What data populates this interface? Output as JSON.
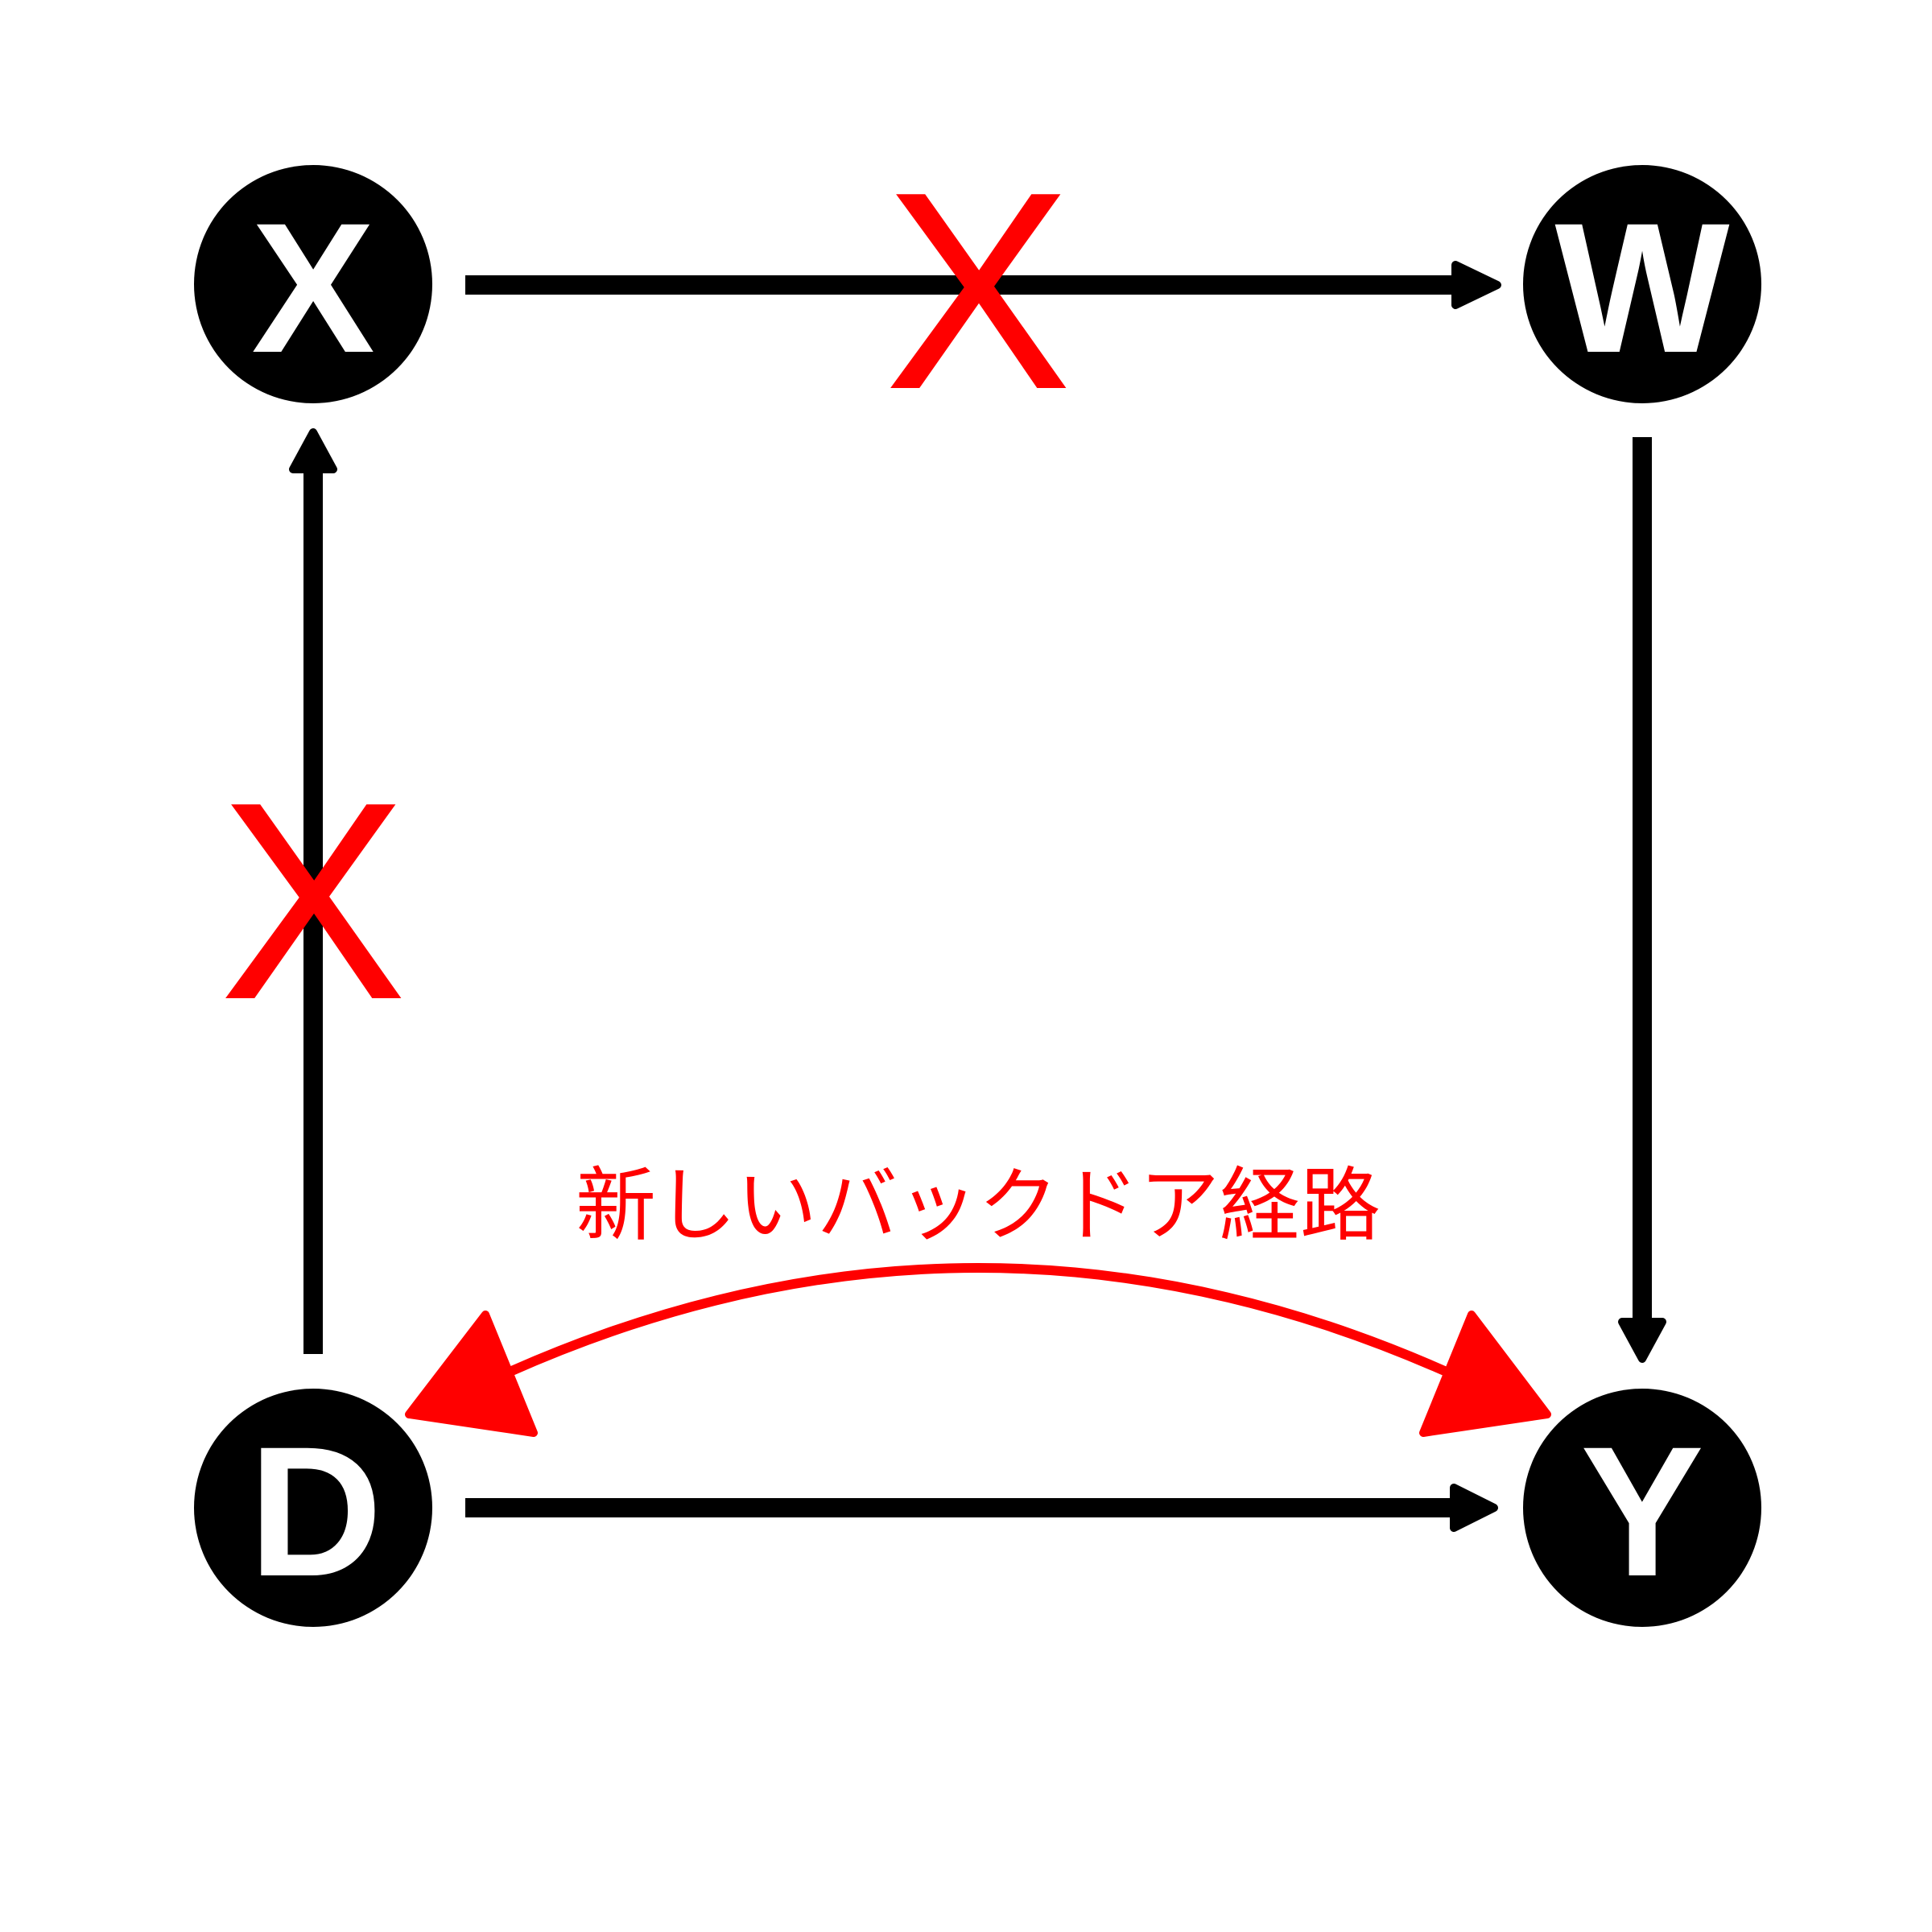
{
  "nodes": {
    "x": {
      "label": "X"
    },
    "w": {
      "label": "W"
    },
    "d": {
      "label": "D"
    },
    "y": {
      "label": "Y"
    }
  },
  "edges": [
    {
      "from": "X",
      "to": "W",
      "removed": true
    },
    {
      "from": "D",
      "to": "X",
      "removed": true
    },
    {
      "from": "W",
      "to": "Y",
      "removed": false
    },
    {
      "from": "D",
      "to": "Y",
      "removed": false
    }
  ],
  "removed_marks": {
    "x_to_w": "X",
    "d_to_x": "X"
  },
  "backdoor": {
    "label": "新しいバックドア経路",
    "bidirectional": true
  },
  "colors": {
    "node_fill": "#000000",
    "node_text": "#ffffff",
    "edge": "#000000",
    "highlight": "#ff0000",
    "background": "#ffffff"
  }
}
